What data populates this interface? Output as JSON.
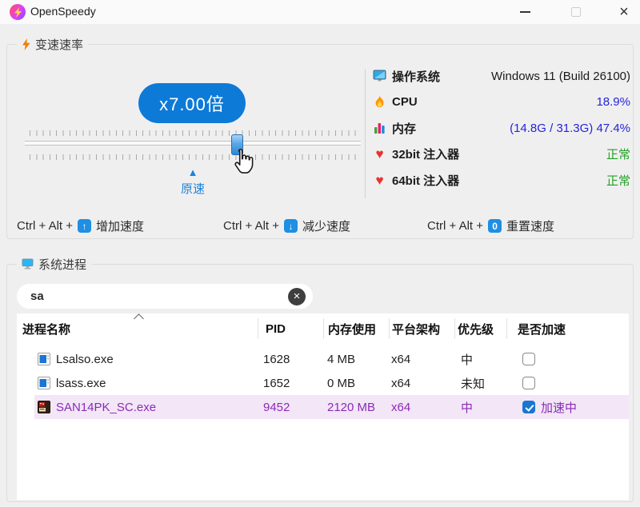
{
  "window": {
    "title": "OpenSpeedy"
  },
  "speed_section": {
    "title": "变速速率",
    "speed_badge": "x7.00倍",
    "reset_label": "原速",
    "info_rows": [
      {
        "icon": "os-icon",
        "label": "操作系统",
        "value": "Windows 11 (Build 26100)"
      },
      {
        "icon": "cpu-icon",
        "label": "CPU",
        "value": "18.9%"
      },
      {
        "icon": "memory-icon",
        "label": "内存",
        "value": "(14.8G / 31.3G) 47.4%"
      },
      {
        "icon": "heart-icon",
        "label": "32bit 注入器",
        "value": "正常"
      },
      {
        "icon": "heart-icon",
        "label": "64bit 注入器",
        "value": "正常"
      }
    ],
    "hotkeys": [
      {
        "prefix": "Ctrl + Alt +",
        "key": "↑",
        "label": "增加速度"
      },
      {
        "prefix": "Ctrl + Alt +",
        "key": "↓",
        "label": "减少速度"
      },
      {
        "prefix": "Ctrl + Alt +",
        "key": "0",
        "label": "重置速度"
      }
    ]
  },
  "process_section": {
    "title": "系统进程",
    "search_value": "sa",
    "columns": [
      "进程名称",
      "PID",
      "内存使用",
      "平台架构",
      "优先级",
      "是否加速"
    ],
    "rows": [
      {
        "name": "Lsalso.exe",
        "pid": "1628",
        "memory": "4 MB",
        "arch": "x64",
        "priority": "中",
        "accel_label": ""
      },
      {
        "name": "lsass.exe",
        "pid": "1652",
        "memory": "0 MB",
        "arch": "x64",
        "priority": "未知",
        "accel_label": ""
      },
      {
        "name": "SAN14PK_SC.exe",
        "pid": "9452",
        "memory": "2120 MB",
        "arch": "x64",
        "priority": "中",
        "accel_label": "加速中"
      }
    ]
  },
  "colors": {
    "accent_blue": "#0e7ad7",
    "key_badge_blue": "#1e8fe3",
    "value_blue": "#2424d8",
    "status_green": "#23a026",
    "heart_red": "#e8322f",
    "highlight_text": "#8b2bb5",
    "highlight_bg": "#f2e6f7"
  }
}
